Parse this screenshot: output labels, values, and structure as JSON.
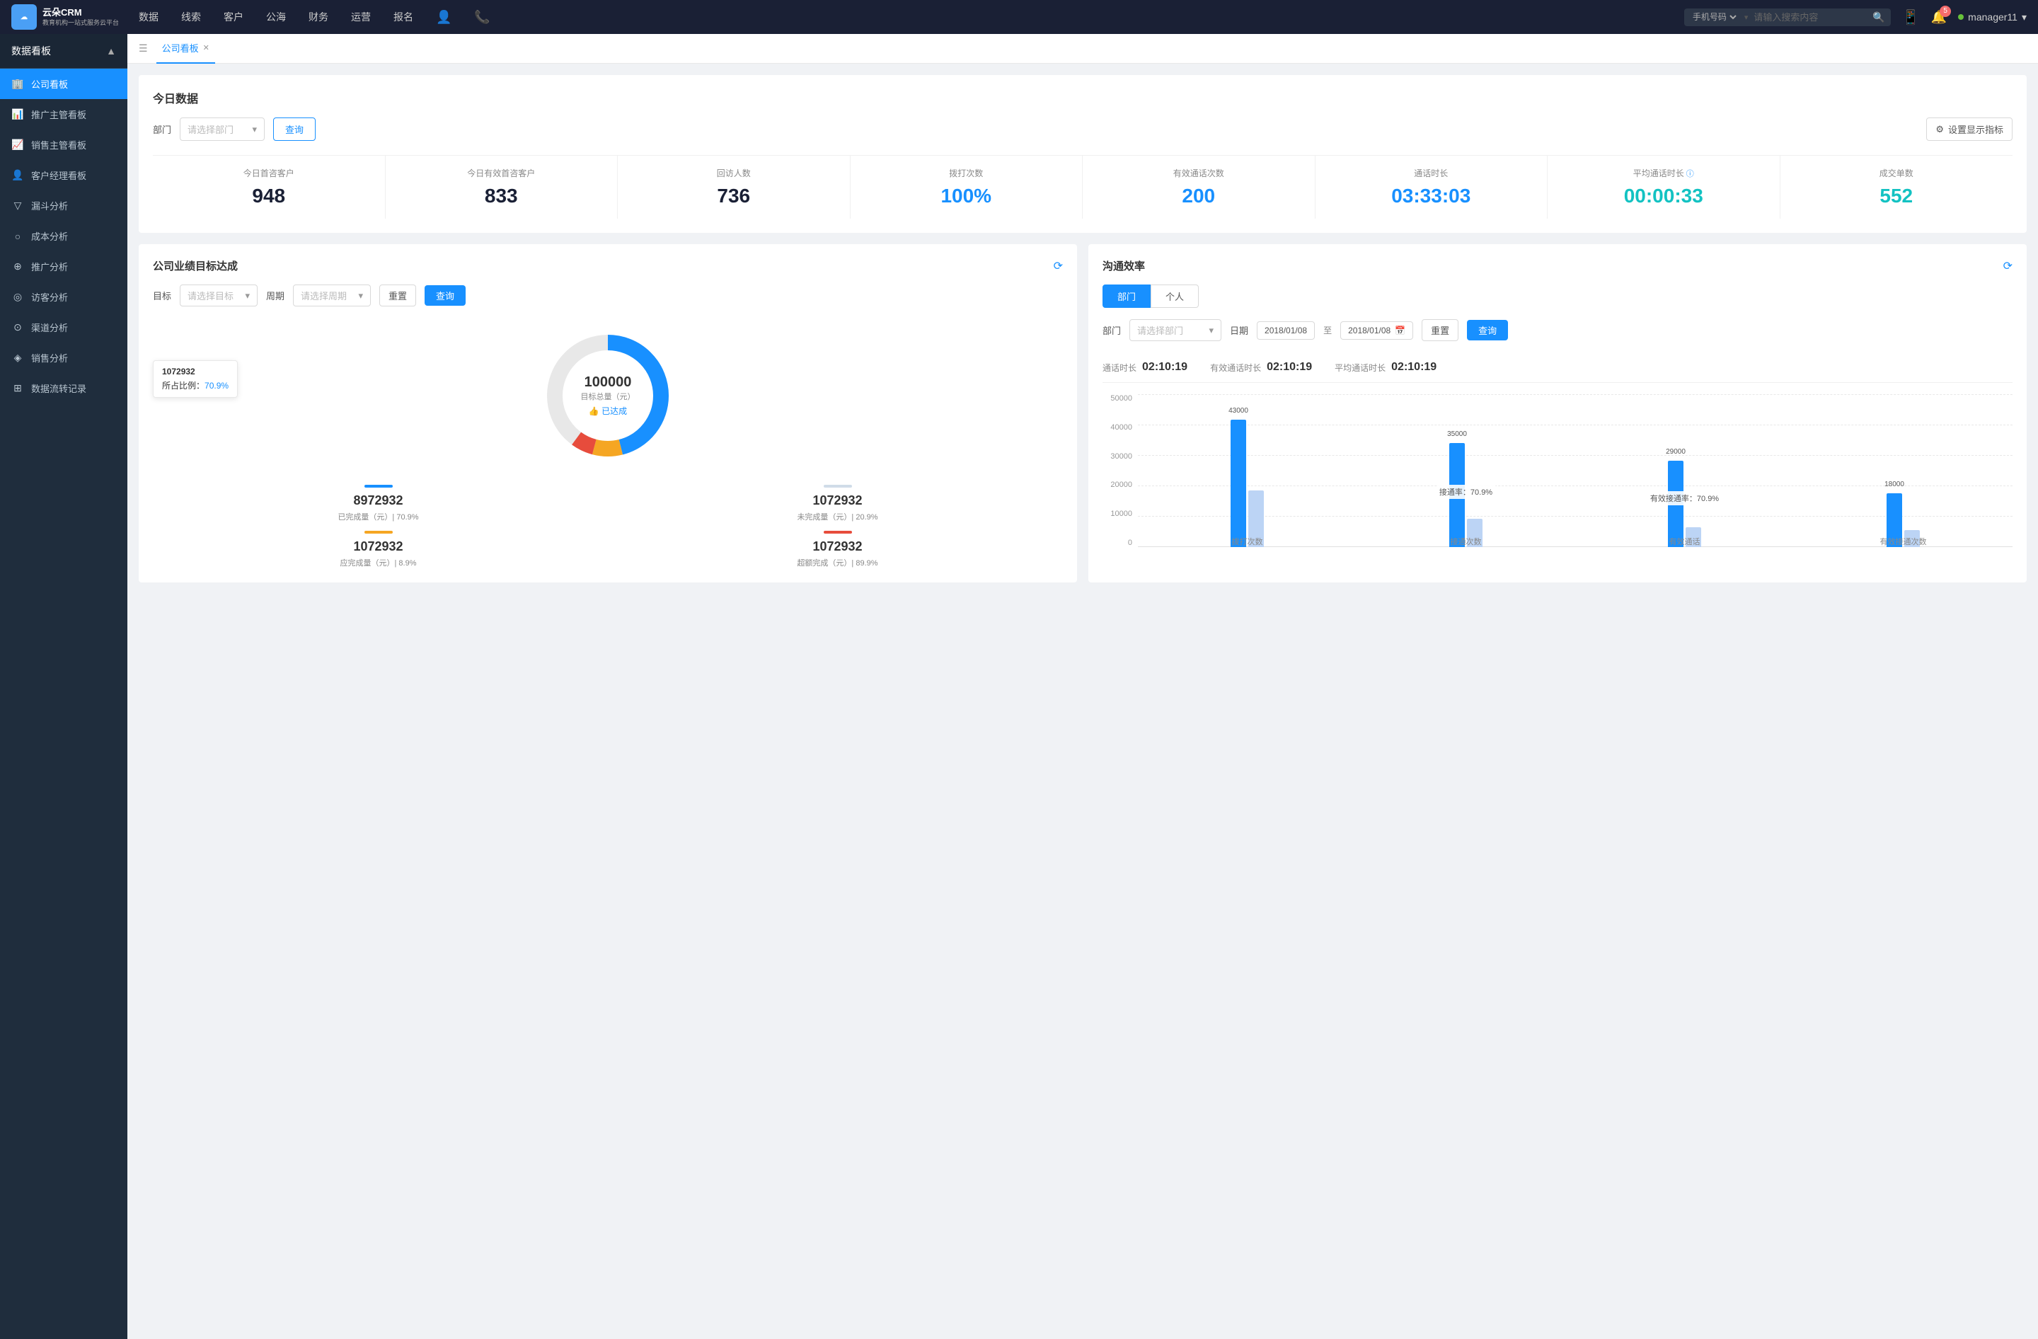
{
  "app": {
    "logo_text_line1": "云朵CRM",
    "logo_text_line2": "教育机构一站式服务云平台"
  },
  "top_nav": {
    "items": [
      "数据",
      "线索",
      "客户",
      "公海",
      "财务",
      "运营",
      "报名"
    ],
    "search_placeholder": "请输入搜索内容",
    "search_type": "手机号码",
    "notification_count": "5",
    "username": "manager11"
  },
  "sidebar": {
    "title": "数据看板",
    "items": [
      {
        "label": "公司看板",
        "icon": "🏢",
        "active": true
      },
      {
        "label": "推广主管看板",
        "icon": "📊",
        "active": false
      },
      {
        "label": "销售主管看板",
        "icon": "📈",
        "active": false
      },
      {
        "label": "客户经理看板",
        "icon": "👤",
        "active": false
      },
      {
        "label": "漏斗分析",
        "icon": "⊿",
        "active": false
      },
      {
        "label": "成本分析",
        "icon": "○",
        "active": false
      },
      {
        "label": "推广分析",
        "icon": "⊕",
        "active": false
      },
      {
        "label": "访客分析",
        "icon": "◎",
        "active": false
      },
      {
        "label": "渠道分析",
        "icon": "⊙",
        "active": false
      },
      {
        "label": "销售分析",
        "icon": "◈",
        "active": false
      },
      {
        "label": "数据流转记录",
        "icon": "⊞",
        "active": false
      }
    ]
  },
  "tabs": [
    {
      "label": "公司看板",
      "active": true,
      "closable": true
    }
  ],
  "today_section": {
    "title": "今日数据",
    "filter_label": "部门",
    "filter_placeholder": "请选择部门",
    "query_btn": "查询",
    "settings_btn": "设置显示指标",
    "stats": [
      {
        "label": "今日首咨客户",
        "value": "948",
        "color": "dark"
      },
      {
        "label": "今日有效首咨客户",
        "value": "833",
        "color": "dark"
      },
      {
        "label": "回访人数",
        "value": "736",
        "color": "dark"
      },
      {
        "label": "拨打次数",
        "value": "100%",
        "color": "blue"
      },
      {
        "label": "有效通话次数",
        "value": "200",
        "color": "blue"
      },
      {
        "label": "通话时长",
        "value": "03:33:03",
        "color": "blue"
      },
      {
        "label": "平均通话时长",
        "value": "00:00:33",
        "color": "cyan"
      },
      {
        "label": "成交单数",
        "value": "552",
        "color": "cyan"
      }
    ]
  },
  "target_panel": {
    "title": "公司业绩目标达成",
    "target_label": "目标",
    "target_placeholder": "请选择目标",
    "period_label": "周期",
    "period_placeholder": "请选择周期",
    "reset_btn": "重置",
    "query_btn": "查询",
    "tooltip_value": "1072932",
    "tooltip_percent": "70.9%",
    "tooltip_percent_label": "所占比例：",
    "donut_center_value": "100000",
    "donut_center_label": "目标总量（元）",
    "donut_center_badge": "👍 已达成",
    "stats": [
      {
        "indicator_color": "#1890ff",
        "value": "8972932",
        "label": "已完成量（元）| 70.9%"
      },
      {
        "indicator_color": "#e0e6ed",
        "value": "1072932",
        "label": "未完成量（元）| 20.9%"
      },
      {
        "indicator_color": "#f5a623",
        "value": "1072932",
        "label": "应完成量（元）| 8.9%"
      },
      {
        "indicator_color": "#e74c3c",
        "value": "1072932",
        "label": "超额完成（元）| 89.9%"
      }
    ]
  },
  "comm_panel": {
    "title": "沟通效率",
    "tab_dept": "部门",
    "tab_person": "个人",
    "dept_label": "部门",
    "dept_placeholder": "请选择部门",
    "date_label": "日期",
    "date_from": "2018/01/08",
    "date_to": "2018/01/08",
    "reset_btn": "重置",
    "query_btn": "查询",
    "stats": [
      {
        "label": "通话时长",
        "value": "02:10:19"
      },
      {
        "label": "有效通话时长",
        "value": "02:10:19"
      },
      {
        "label": "平均通话时长",
        "value": "02:10:19"
      }
    ],
    "chart": {
      "y_labels": [
        "50000",
        "40000",
        "30000",
        "20000",
        "10000",
        "0"
      ],
      "groups": [
        {
          "x_label": "拨打次数",
          "bars": [
            {
              "height_pct": 86,
              "value": "43000",
              "color": "blue"
            },
            {
              "height_pct": 40,
              "value": "",
              "color": "light"
            }
          ]
        },
        {
          "x_label": "接通次数",
          "annotation": "接通率：70.9%",
          "bars": [
            {
              "height_pct": 70,
              "value": "35000",
              "color": "blue"
            },
            {
              "height_pct": 20,
              "value": "",
              "color": "light"
            }
          ]
        },
        {
          "x_label": "有效通话",
          "annotation": "有效接通率：70.9%",
          "bars": [
            {
              "height_pct": 58,
              "value": "29000",
              "color": "blue"
            },
            {
              "height_pct": 14,
              "value": "",
              "color": "light"
            }
          ]
        },
        {
          "x_label": "有效接通次数",
          "bars": [
            {
              "height_pct": 36,
              "value": "18000",
              "color": "blue"
            },
            {
              "height_pct": 12,
              "value": "",
              "color": "light"
            }
          ]
        }
      ]
    }
  }
}
